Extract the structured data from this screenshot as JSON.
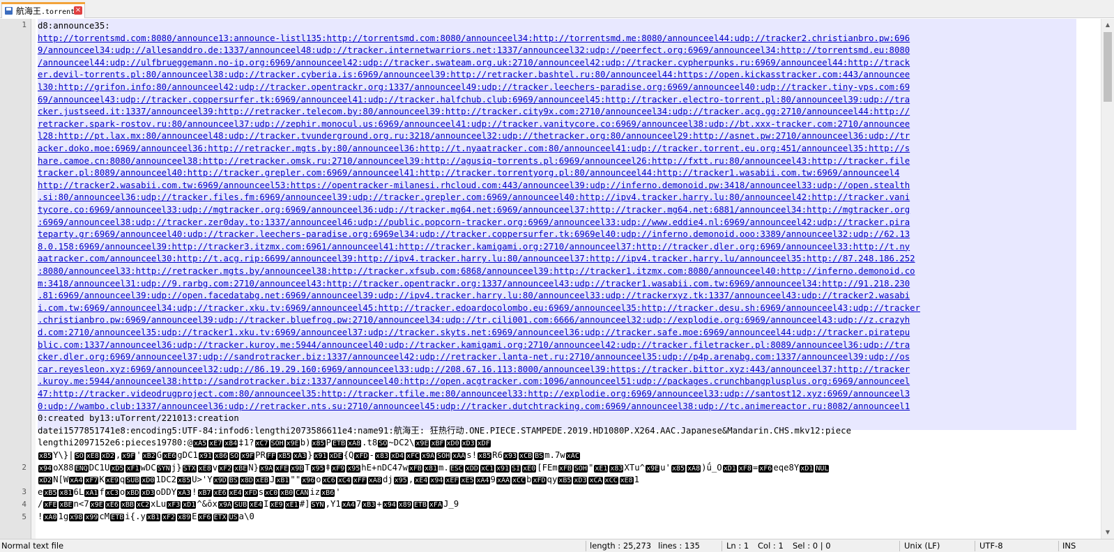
{
  "tab": {
    "title": "航海王",
    "ext": ".torrent"
  },
  "gutter": [
    "1",
    "2",
    "3",
    "4",
    "5"
  ],
  "lines": [
    {
      "t": "d8:announce35:"
    },
    {
      "t": "http://torrentsmd.com:8080/announce13:announce-listl135:http://torrentsmd.com:8080/announceel34:http://torrentsmd.me:8080/announceel44:udp://tracker2.christianbro.pw:696",
      "url": true
    },
    {
      "t": "9/announceel34:udp://allesanddro.de:1337/announceel48:udp://tracker.internetwarriors.net:1337/announceel32:udp://peerfect.org:6969/announceel34:http://torrentsmd.eu:8080",
      "url": true
    },
    {
      "t": "/announceel44:udp://ulfbrueggemann.no-ip.org:6969/announceel42:udp://tracker.swateam.org.uk:2710/announceel42:udp://tracker.cypherpunks.ru:6969/announceel44:http://track",
      "url": true
    },
    {
      "t": "er.devil-torrents.pl:80/announceel38:udp://tracker.cyberia.is:6969/announceel39:http://retracker.bashtel.ru:80/announceel44:https://open.kickasstracker.com:443/announcee",
      "url": true
    },
    {
      "t": "l30:http://grifon.info:80/announceel42:udp://tracker.opentrackr.org:1337/announceel49:udp://tracker.leechers-paradise.org:6969/announceel40:udp://tracker.tiny-vps.com:69",
      "url": true
    },
    {
      "t": "69/announceel43:udp://tracker.coppersurfer.tk:6969/announceel41:udp://tracker.halfchub.club:6969/announceel45:http://tracker.electro-torrent.pl:80/announceel39:udp://tra",
      "url": true
    },
    {
      "t": "cker.justseed.it:1337/announceel39:http://retracker.telecom.by:80/announceel39:http://tracker.city9x.com:2710/announceel34:udp://tracker.acg.gg:2710/announceel44:http://",
      "url": true
    },
    {
      "t": "retracker.spark-rostov.ru:80/announceel37:udp://zephir.monocul.us:6969/announceel41:udp://tracker.vanitycore.co:6969/announceel38:udp://bt.xxx-tracker.com:2710/announcee",
      "url": true
    },
    {
      "t": "l28:http://pt.lax.mx:80/announceel48:udp://tracker.tvunderground.org.ru:3218/announceel32:udp://thetracker.org:80/announceel29:http://asnet.pw:2710/announceel36:udp://tr",
      "url": true
    },
    {
      "t": "acker.doko.moe:6969/announceel36:http://retracker.mgts.by:80/announceel36:http://t.nyaatracker.com:80/announceel41:udp://tracker.torrent.eu.org:451/announceel35:http://s",
      "url": true
    },
    {
      "t": "hare.camoe.cn:8080/announceel38:http://retracker.omsk.ru:2710/announceel39:http://agusiq-torrents.pl:6969/announceel26:http://fxtt.ru:80/announceel43:http://tracker.file",
      "url": true
    },
    {
      "t": "tracker.pl:8089/announceel40:http://tracker.grepler.com:6969/announceel41:http://tracker.torrentyorg.pl:80/announceel44:http://tracker1.wasabii.com.tw:6969/announceel4",
      "url": true
    },
    {
      "t": "http://tracker2.wasabii.com.tw:6969/announceel53:https://opentracker-milanesi.rhcloud.com:443/announceel39:udp://inferno.demonoid.pw:3418/announceel33:udp://open.stealth",
      "url": true
    },
    {
      "t": ".si:80/announceel36:udp://tracker.files.fm:6969/announceel39:udp://tracker.grepler.com:6969/announceel40:http://ipv4.tracker.harry.lu:80/announceel42:http://tracker.vani",
      "url": true
    },
    {
      "t": "tycore.co:6969/announceel33:udp://mgtracker.org:6969/announceel36:udp://tracker.mg64.net:6969/announceel37:http://tracker.mg64.net:6881/announceel34:http://mgtracker.org",
      "url": true
    },
    {
      "t": ":6969/announceel38:udp://tracker.zer0day.to:1337/announceel46:udp://public.popcorn-tracker.org:6969/announceel33:udp://www.eddie4.nl:6969/announceel42:udp://tracker.pira",
      "url": true
    },
    {
      "t": "teparty.gr:6969/announceel40:udp://tracker.leechers-paradise.org:6969el34:udp://tracker.coppersurfer.tk:6969el40:udp://inferno.demonoid.ooo:3389/announceel32:udp://62.13",
      "url": true
    },
    {
      "t": "8.0.158:6969/announceel39:http://tracker3.itzmx.com:6961/announceel41:http://tracker.kamigami.org:2710/announceel37:http://tracker.dler.org:6969/announceel33:http://t.ny",
      "url": true
    },
    {
      "t": "aatracker.com/announceel30:http://t.acg.rip:6699/announceel39:http://ipv4.tracker.harry.lu:80/announceel37:http://ipv4.tracker.harry.lu/announceel35:http://87.248.186.252",
      "url": true
    },
    {
      "t": ":8080/announceel33:http://retracker.mgts.by/announceel38:http://tracker.xfsub.com:6868/announceel39:http://tracker1.itzmx.com:8080/announceel40:http://inferno.demonoid.co",
      "url": true
    },
    {
      "t": "m:3418/announceel31:udp://9.rarbg.com:2710/announceel43:http://tracker.opentrackr.org:1337/announceel43:udp://tracker1.wasabii.com.tw:6969/announceel34:http://91.218.230",
      "url": true
    },
    {
      "t": ".81:6969/announceel39:udp://open.facedatabg.net:6969/announceel39:udp://ipv4.tracker.harry.lu:80/announceel33:udp://trackerxyz.tk:1337/announceel43:udp://tracker2.wasabi",
      "url": true
    },
    {
      "t": "i.com.tw:6969/announceel34:udp://tracker.xku.tv:6969/announceel45:http://tracker.edoardocolombo.eu:6969/announceel35:http://tracker.desu.sh:6969/announceel43:udp://tracker",
      "url": true
    },
    {
      "t": ".christianbro.pw:6969/announceel39:udp://tracker.bluefrog.pw:2710/announceel34:udp://tr.cili001.com:6666/announceel32:udp://explodie.org:6969/announceel43:udp://z.crazyh",
      "url": true
    },
    {
      "t": "d.com:2710/announceel35:udp://tracker1.xku.tv:6969/announceel37:udp://tracker.skyts.net:6969/announceel36:udp://tracker.safe.moe:6969/announceel44:udp://tracker.piratepu",
      "url": true
    },
    {
      "t": "blic.com:1337/announceel36:udp://tracker.kuroy.me:5944/announceel40:udp://tracker.kamigami.org:2710/announceel42:udp://tracker.filetracker.pl:8089/announceel36:udp://tra",
      "url": true
    },
    {
      "t": "cker.dler.org:6969/announceel37:udp://sandrotracker.biz:1337/announceel42:udp://retracker.lanta-net.ru:2710/announceel35:udp://p4p.arenabg.com:1337/announceel39:udp://os",
      "url": true
    },
    {
      "t": "car.reyesleon.xyz:6969/announceel32:udp://86.19.29.160:6969/announceel33:udp://208.67.16.113:8000/announceel39:https://tracker.bittor.xyz:443/announceel37:http://tracker",
      "url": true
    },
    {
      "t": ".kuroy.me:5944/announceel38:http://sandrotracker.biz:1337/announceel40:http://open.acgtracker.com:1096/announceel51:udp://packages.crunchbangplusplus.org:6969/announceel",
      "url": true
    },
    {
      "t": "47:http://tracker.videodrugproject.com:80/announceel35:http://tracker.tfile.me:80/announceel33:http://explodie.org:6969/announceel33:udp://santost12.xyz:6969/announceel3",
      "url": true
    },
    {
      "t": "0:udp://wambo.club:1337/announceel36:udp://retracker.nts.su:2710/announceel45:udp://tracker.dutchtracking.com:6969/announceel38:udp://tc.animereactor.ru:8082/announceel1",
      "url": true
    },
    {
      "t": "0:created by13:uTorrent/221013:creation"
    },
    {
      "t": "datei1577851741e8:encoding5:UTF-84:infod6:lengthi2073586611e4:name91:航海王: 狂热行动.ONE.PIECE.STAMPEDE.2019.HD1080P.X264.AAC.Japanese&Mandarin.CHS.mkv12:piece"
    },
    {
      "t": "lengthi2097152e6:pieces19780:@xA5xE7x84‡1?xC7SOHx9Eb)x85PETBxA8.t8SO~DC2\\x9ExBFxD0xD3xDF"
    },
    {
      "t": "x85Y\\}|SOxE8xD2,x9F'xB2GxE6gDC1x91x86SOx9FPRFFxB5xA3}x91xDE{QxFD-x83xD4xFCx9ASOHxAAs!x85R6x93xCBBSm.7wxAC"
    },
    {
      "t": "x94oX88ENQDC1UxD5xF1wDCSYNj}STXxE8vxF2xBEN}x9AxFEx9BTx95ǂxF9x95hE+nDC47wxFBx81m.ESCxDDxC1x91SIxE0[FEmxFBSOH\"xE1x83XTu^x9Eu'x85xA8)ǘ_OxD1xF8=xF6eqe8YxD1NUL"
    },
    {
      "t": "xD2N[WxA4xF7KxE9qSUBxD01DC2x85U>'Yx9DBSx8DxEBJxB1\"\"x96oxC6xC4xFFxA8djx95,xE4x94xEFxE5xA49xAAxCCbxFDqyxB5xD3xCAxCCxE81"
    },
    {
      "t": "exB5x816LxA1fxC3oxBDxD3oDDYxA3!xB7xE6xE4xFDsxC0xB0CANizxB6'"
    },
    {
      "t": "/xFExBEn<7x9ExE6xBBxC2xLuxF3xD1^&ōxx9ASUBxE4IxE9xE1#]SYN,Y1xA47xB3+x94x89ETBxFAJ_9"
    },
    {
      "t": "!xA01gx98x99cMETBi{.yxB1xF2x89ExF6ETXUSa\\0"
    }
  ],
  "status": {
    "filetype": "Normal text file",
    "length": "length : 25,273",
    "lines": "lines : 135",
    "ln": "Ln : 1",
    "col": "Col : 1",
    "sel": "Sel : 0 | 0",
    "eol": "Unix (LF)",
    "encoding": "UTF-8",
    "mode": "INS"
  }
}
